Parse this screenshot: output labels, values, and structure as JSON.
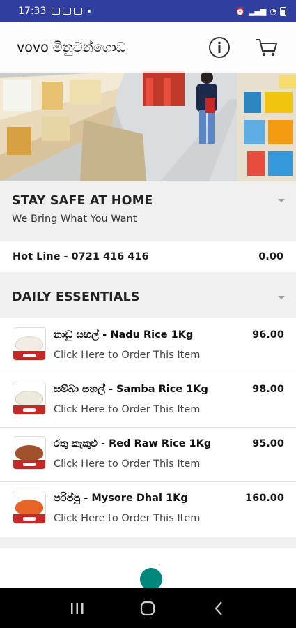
{
  "status_bar": {
    "time": "17:33"
  },
  "app_bar": {
    "title": "vovo මිනුවන්ගොඩ"
  },
  "sections": {
    "stay_safe": {
      "title": "STAY SAFE AT HOME",
      "subtitle": "We Bring What You Want"
    },
    "daily": {
      "title": "DAILY ESSENTIALS"
    }
  },
  "hotline": {
    "label": "Hot Line - 0721 416 416",
    "price": "0.00"
  },
  "items": [
    {
      "name": "නාඩු සහල් - Nadu Rice 1Kg",
      "price": "96.00",
      "cta": "Click Here to Order This Item",
      "color": "#f2ede4"
    },
    {
      "name": "සම්බා සහල් - Samba Rice 1Kg",
      "price": "98.00",
      "cta": "Click Here to Order This Item",
      "color": "#eee9dd"
    },
    {
      "name": "රතු කැකුළු - Red Raw Rice 1Kg",
      "price": "95.00",
      "cta": "Click Here to Order This Item",
      "color": "#a0522d"
    },
    {
      "name": "පරිප්පු - Mysore Dhal 1Kg",
      "price": "160.00",
      "cta": "Click Here to Order This Item",
      "color": "#e8652a"
    }
  ],
  "icons": {
    "info": "info-icon",
    "cart": "cart-icon",
    "recents": "recents-icon",
    "home": "home-icon",
    "back": "back-icon"
  },
  "colors": {
    "status_bar": "#303f9f",
    "fab": "#00897b",
    "thumb_band": "#c62828"
  }
}
